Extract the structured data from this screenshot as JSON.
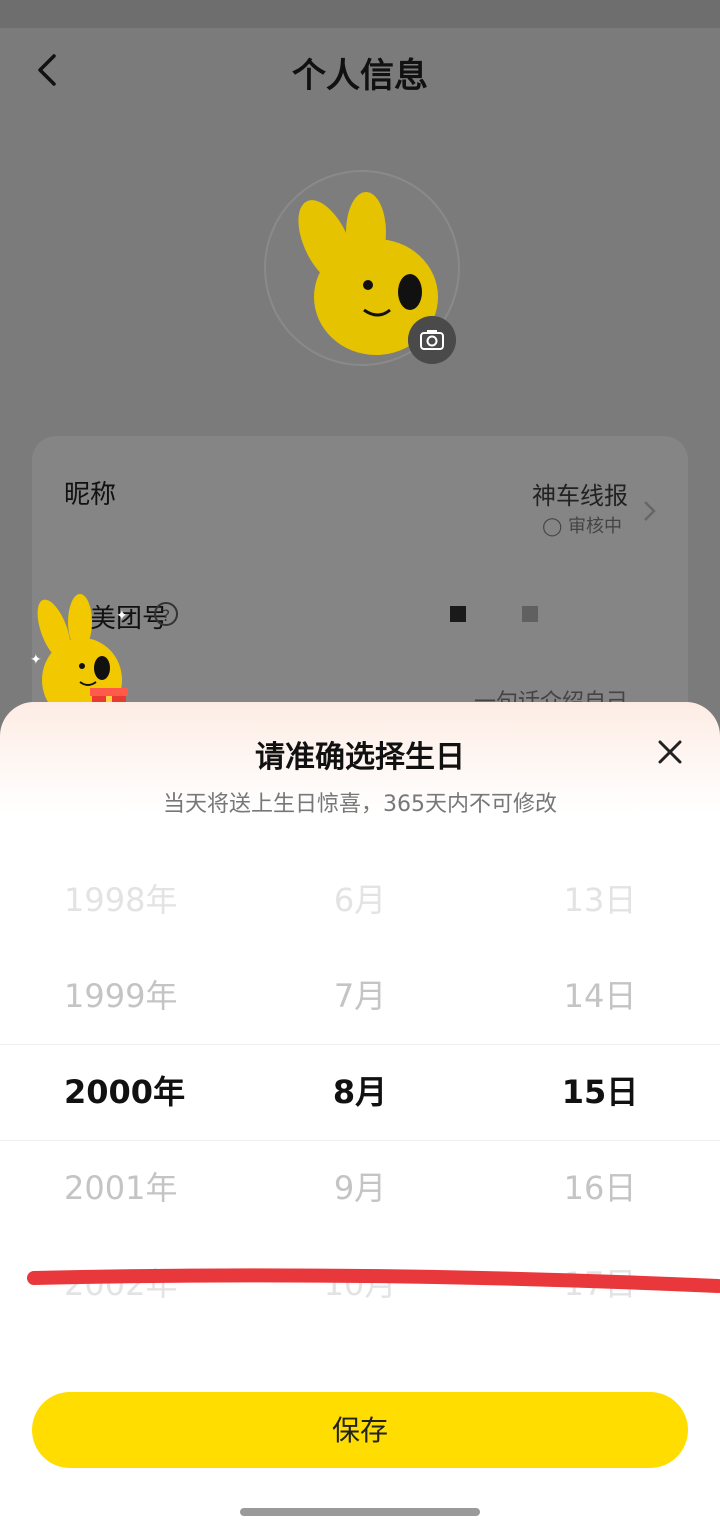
{
  "header": {
    "title": "个人信息"
  },
  "profile": {
    "nickname_label": "昵称",
    "nickname_value": "神车线报",
    "nickname_sub": "◯ 审核中",
    "team_label": "美团号",
    "help_symbol": "?",
    "intro_value": "一句话介绍自己"
  },
  "birthday_sheet": {
    "title": "请准确选择生日",
    "subtitle": "当天将送上生日惊喜，365天内不可修改",
    "years": [
      "1998年",
      "1999年",
      "2000年",
      "2001年",
      "2002年"
    ],
    "months": [
      "6月",
      "7月",
      "8月",
      "9月",
      "10月"
    ],
    "days": [
      "13日",
      "14日",
      "15日",
      "16日",
      "17日"
    ],
    "save_label": "保存"
  },
  "colors": {
    "accent": "#ffdd00",
    "annotation": "#e8383c"
  }
}
